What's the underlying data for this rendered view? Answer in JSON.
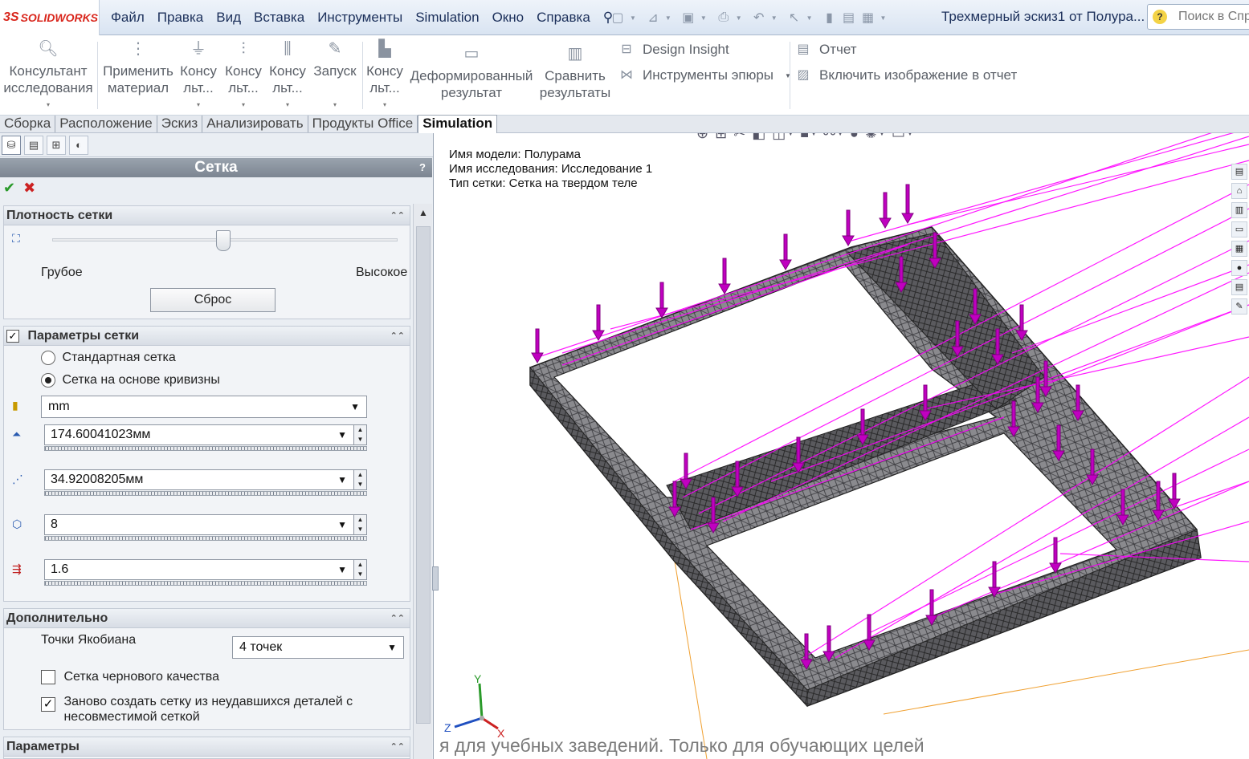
{
  "app": {
    "logo_ds": "3S",
    "logo_text": "SOLIDWORKS",
    "menu": [
      "Файл",
      "Правка",
      "Вид",
      "Вставка",
      "Инструменты",
      "Simulation",
      "Окно",
      "Справка"
    ],
    "doc_title": "Трехмерный эскиз1 от Полура...",
    "search_placeholder": "Поиск в Спр"
  },
  "ribbon": {
    "consultant": [
      "Консультант",
      "исследования"
    ],
    "apply_material": [
      "Применить",
      "материал"
    ],
    "consult1": [
      "Консу",
      "льт..."
    ],
    "consult2": [
      "Консу",
      "льт..."
    ],
    "consult3": [
      "Консу",
      "льт..."
    ],
    "run": "Запуск",
    "consult4": [
      "Консу",
      "льт..."
    ],
    "deformed": [
      "Деформированный",
      "результат"
    ],
    "compare": [
      "Сравнить",
      "результаты"
    ],
    "design_insight": "Design Insight",
    "plot_tools": "Инструменты эпюры",
    "report": "Отчет",
    "include_image": "Включить изображение в отчет"
  },
  "tabs": [
    "Сборка",
    "Расположение",
    "Эскиз",
    "Анализировать",
    "Продукты Office",
    "Simulation"
  ],
  "panel": {
    "title": "Сетка",
    "help": "?",
    "density": {
      "title": "Плотность сетки",
      "coarse": "Грубое",
      "fine": "Высокое",
      "reset": "Сброс",
      "slider_position": 0.5
    },
    "params": {
      "title": "Параметры сетки",
      "standard": "Стандартная сетка",
      "curvature": "Сетка на основе кривизны",
      "unit": "mm",
      "max_size": "174.60041023мм",
      "min_size": "34.92008205мм",
      "circle_elements": "8",
      "growth_ratio": "1.6"
    },
    "advanced": {
      "title": "Дополнительно",
      "jacobian_label": "Точки Якобиана",
      "jacobian_value": "4 точек",
      "draft_quality": "Сетка чернового качества",
      "remesh_line1": "Заново создать сетку из неудавшихся деталей с",
      "remesh_line2": "несовместимой сеткой"
    },
    "options": {
      "title": "Параметры"
    }
  },
  "viewport": {
    "model_name": "Имя модели: Полурама",
    "study_name": "Имя  исследования: Исследование 1",
    "mesh_type": "Тип сетки: Сетка на твердом теле",
    "watermark": "я для учебных заведений. Только для обучающих целей",
    "axis_x": "X",
    "axis_y": "Y",
    "axis_z": "Z"
  },
  "colors": {
    "accent_magenta": "#ff00ff",
    "logo_red": "#d9261c",
    "mesh_gray": "#6e6e72"
  }
}
